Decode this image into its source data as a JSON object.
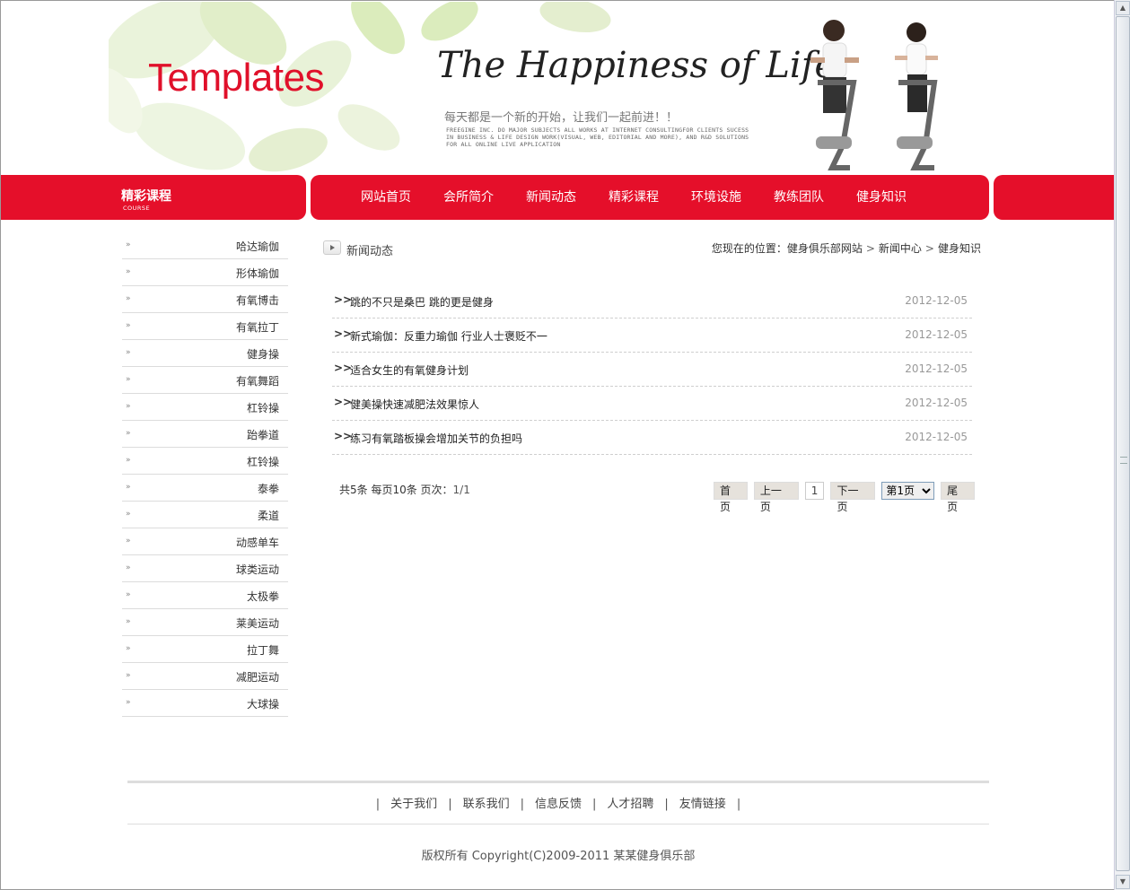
{
  "header": {
    "logo": "Templates",
    "slogan_en": "The Happiness of Life",
    "slogan_cn": "每天都是一个新的开始，让我们一起前进！！",
    "slogan_small": "FREEGINE INC. DO MAJOR SUBJECTS ALL WORKS AT INTERNET CONSULTINGFOR CLIENTS SUCESS IN BUSINESS & LIFE DESIGN WORK(VISUAL, WEB, EDITORIAL AND MORE), AND R&D SOLUTIONS FOR ALL ONLINE LIVE APPLICATION"
  },
  "nav": {
    "section_title": "精彩课程",
    "section_sub": "COURSE",
    "items": [
      "网站首页",
      "会所简介",
      "新闻动态",
      "精彩课程",
      "环境设施",
      "教练团队",
      "健身知识"
    ]
  },
  "sidebar": {
    "arrow": "»",
    "items": [
      "哈达瑜伽",
      "形体瑜伽",
      "有氧博击",
      "有氧拉丁",
      "健身操",
      "有氧舞蹈",
      "杠铃操",
      "跆拳道",
      "杠铃操",
      "泰拳",
      "柔道",
      "动感单车",
      "球类运动",
      "太极拳",
      "莱美运动",
      "拉丁舞",
      "减肥运动",
      "大球操"
    ]
  },
  "main": {
    "title": "新闻动态",
    "breadcrumb": {
      "prefix": "您现在的位置：",
      "items": [
        "健身俱乐部网站",
        "新闻中心",
        "健身知识"
      ]
    },
    "news": [
      {
        "title": "跳的不只是桑巴 跳的更是健身",
        "date": "2012-12-05"
      },
      {
        "title": "新式瑜伽：反重力瑜伽 行业人士褒贬不一",
        "date": "2012-12-05"
      },
      {
        "title": "适合女生的有氧健身计划",
        "date": "2012-12-05"
      },
      {
        "title": "健美操快速减肥法效果惊人",
        "date": "2012-12-05"
      },
      {
        "title": "练习有氧踏板操会增加关节的负担吗",
        "date": "2012-12-05"
      }
    ],
    "pager": {
      "info": "共5条  每页10条  页次：",
      "page": "1/1",
      "first": "首页",
      "prev": "上一页",
      "current": "1",
      "next": "下一页",
      "select_value": "第1页",
      "last": "尾页"
    }
  },
  "footer": {
    "links": [
      "关于我们",
      "联系我们",
      "信息反馈",
      "人才招聘",
      "友情链接"
    ],
    "copyright": "版权所有 Copyright(C)2009-2011 某某健身俱乐部"
  },
  "colors": {
    "brand_red": "#e50f2a",
    "leaf_green": "#c9e3a0"
  }
}
